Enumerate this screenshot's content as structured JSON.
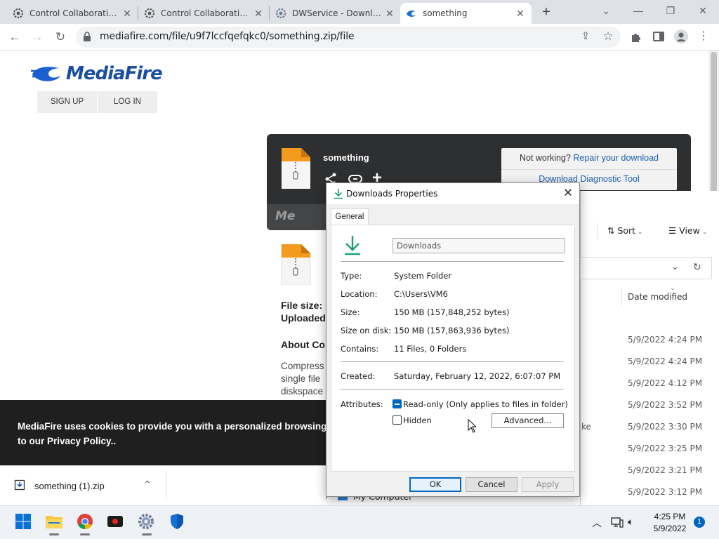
{
  "browser": {
    "tabs": [
      {
        "title": "Control Collaborative V",
        "icon": "dwservice-gear-icon"
      },
      {
        "title": "Control Collaborative V",
        "icon": "dwservice-gear-icon"
      },
      {
        "title": "DWService - Download",
        "icon": "dwservice-gear-icon"
      },
      {
        "title": "something",
        "icon": "mediafire-icon",
        "active": true
      }
    ],
    "url": "mediafire.com/file/u9f7lccfqefqkc0/something.zip/file"
  },
  "page": {
    "logo_text": "MediaFire",
    "sign_up": "SIGN UP",
    "log_in": "LOG IN",
    "file_title": "something",
    "not_working": "Not working?",
    "repair_link": "Repair your download",
    "diagnostic_link": "Download Diagnostic Tool",
    "card_brand": "Me",
    "file_size_label": "File size:",
    "uploaded_label": "Uploaded",
    "about_label": "About Co",
    "desc_lines": [
      "Compress",
      "single file",
      "diskspace"
    ],
    "cookie_line1": "MediaFire uses cookies to provide you with a personalized browsing experi",
    "cookie_line2_pre": "to our ",
    "cookie_link": "Privacy Policy",
    "cookie_line2_post": ".."
  },
  "download_shelf": {
    "filename": "something (1).zip"
  },
  "explorer": {
    "sort_label": "Sort",
    "view_label": "View",
    "date_header": "Date modified",
    "fragment_text": "ke",
    "my_computer": "My Computer",
    "dates": [
      "5/9/2022 4:24 PM",
      "5/9/2022 4:24 PM",
      "5/9/2022 4:12 PM",
      "5/9/2022 3:52 PM",
      "5/9/2022 3:30 PM",
      "5/9/2022 3:25 PM",
      "5/9/2022 3:21 PM",
      "5/9/2022 3:12 PM"
    ]
  },
  "dialog": {
    "title": "Downloads Properties",
    "tab": "General",
    "name_value": "Downloads",
    "props": [
      {
        "label": "Type:",
        "value": "System Folder"
      },
      {
        "label": "Location:",
        "value": "C:\\Users\\VM6"
      },
      {
        "label": "Size:",
        "value": "150 MB (157,848,252 bytes)"
      },
      {
        "label": "Size on disk:",
        "value": "150 MB (157,863,936 bytes)"
      },
      {
        "label": "Contains:",
        "value": "11 Files, 0 Folders"
      }
    ],
    "created_label": "Created:",
    "created_value": "Saturday, February 12, 2022, 6:07:07 PM",
    "attributes_label": "Attributes:",
    "readonly_label": "Read-only (Only applies to files in folder)",
    "hidden_label": "Hidden",
    "advanced_button": "Advanced...",
    "ok_button": "OK",
    "cancel_button": "Cancel",
    "apply_button": "Apply"
  },
  "taskbar": {
    "time": "4:25 PM",
    "date": "5/9/2022",
    "notification_count": "1"
  },
  "colors": {
    "accent": "#0067c0",
    "mediafire_blue": "#1a4fa0",
    "link_blue": "#1a5fb4",
    "card_dark": "#2e2f31"
  }
}
